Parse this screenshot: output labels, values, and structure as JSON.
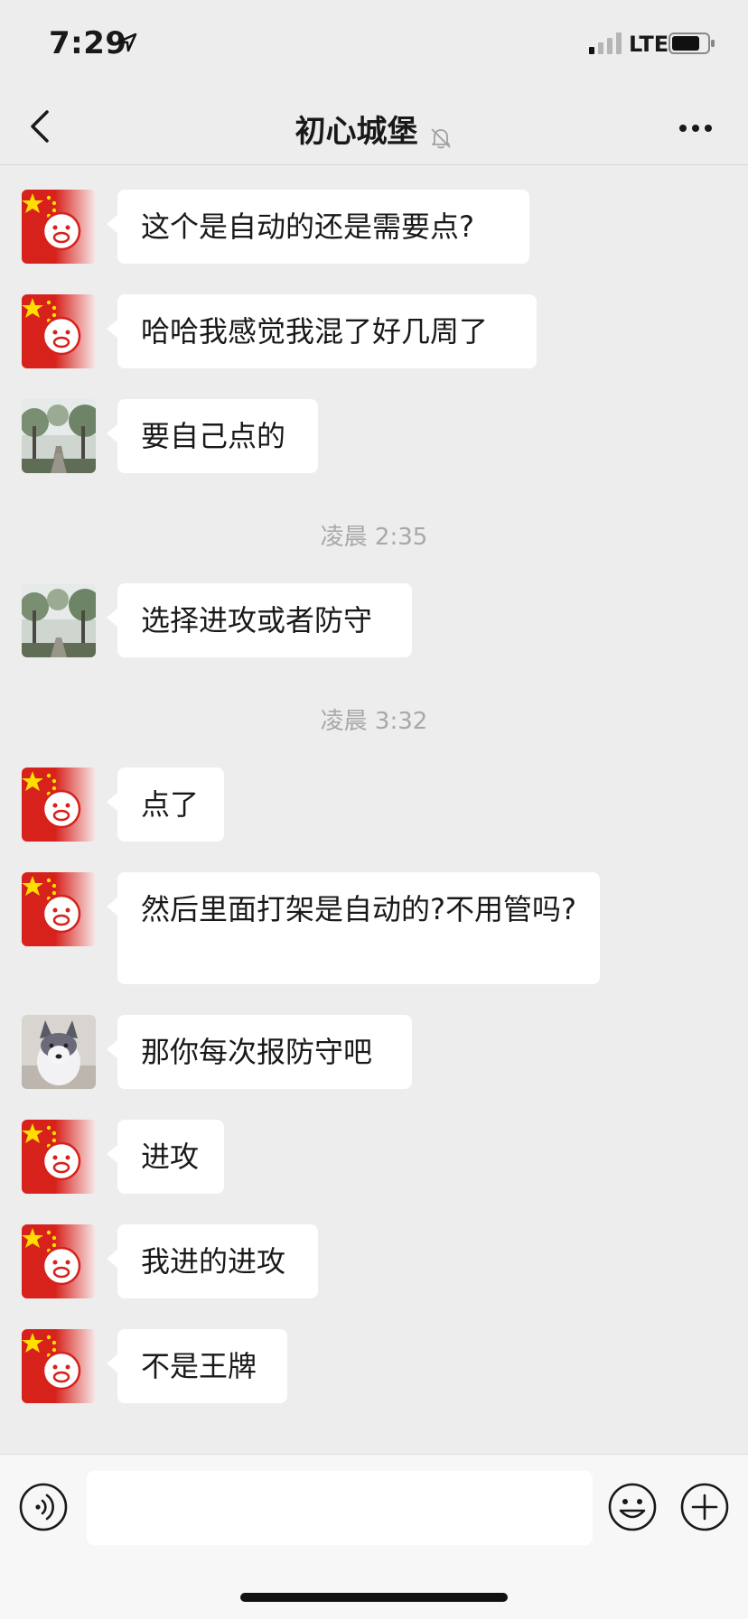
{
  "status_bar": {
    "time": "7:29",
    "network": "LTE"
  },
  "header": {
    "title": "初心城堡"
  },
  "timestamps": [
    "凌晨 2:35",
    "凌晨 3:32"
  ],
  "messages": [
    {
      "avatar": "flag-avatar",
      "text": "这个是自动的还是需要点?"
    },
    {
      "avatar": "flag-avatar",
      "text": "哈哈我感觉我混了好几周了"
    },
    {
      "avatar": "trees-avatar",
      "text": "要自己点的"
    },
    {
      "avatar": "trees-avatar",
      "text": "选择进攻或者防守"
    },
    {
      "avatar": "flag-avatar",
      "text": "点了"
    },
    {
      "avatar": "flag-avatar",
      "text": "然后里面打架是自动的?不用管吗?"
    },
    {
      "avatar": "dog-avatar",
      "text": "那你每次报防守吧"
    },
    {
      "avatar": "flag-avatar",
      "text": "进攻"
    },
    {
      "avatar": "flag-avatar",
      "text": "我进的进攻"
    },
    {
      "avatar": "flag-avatar",
      "text": "不是王牌"
    }
  ],
  "input": {
    "value": "",
    "placeholder": ""
  },
  "icons": {
    "back": "chevron-left-icon",
    "mute": "bell-slash-icon",
    "more": "more-dots-icon",
    "voice": "voice-icon",
    "emoji": "emoji-icon",
    "plus": "plus-icon"
  }
}
